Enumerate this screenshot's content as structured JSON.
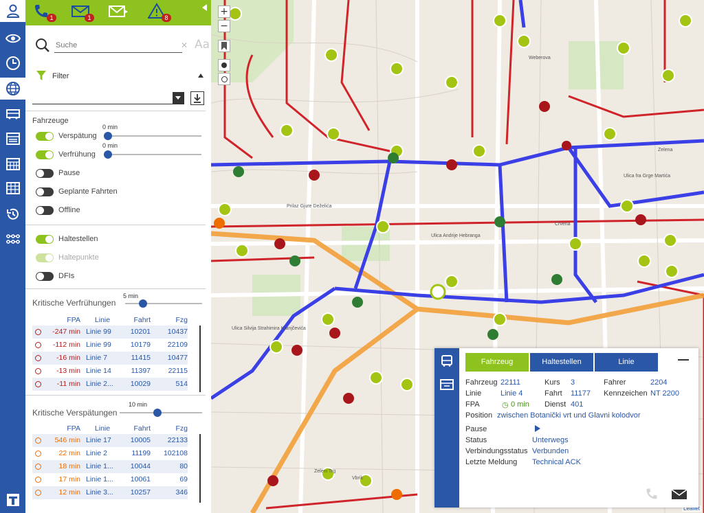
{
  "topbar": {
    "badges": {
      "phone": "1",
      "mail": "1",
      "alerts": "8"
    }
  },
  "colors": {
    "brand_blue": "#2a57a6",
    "accent_green": "#8ec31f",
    "alert_red": "#c0221c",
    "late_orange": "#ef6c00",
    "early_red": "#b71c1c"
  },
  "nav": [
    {
      "icon": "user-icon"
    },
    {
      "icon": "eye-icon"
    },
    {
      "icon": "clock-icon"
    },
    {
      "icon": "globe-icon"
    },
    {
      "icon": "bus-icon"
    },
    {
      "icon": "timetable-icon"
    },
    {
      "icon": "calendar-icon"
    },
    {
      "icon": "schedule-grid-icon"
    },
    {
      "icon": "history-icon"
    },
    {
      "icon": "route-network-icon"
    }
  ],
  "search": {
    "placeholder": "Suche",
    "font_size_label": "Aa"
  },
  "filter": {
    "label": "Filter"
  },
  "vehicles": {
    "title": "Fahrzeuge",
    "delay": {
      "label": "Verspätung",
      "on": true,
      "slider_value": "0 min",
      "slider_level": 0
    },
    "early": {
      "label": "Verfrühung",
      "on": true,
      "slider_value": "0 min",
      "slider_level": 0
    },
    "pause": {
      "label": "Pause",
      "on": false
    },
    "planned": {
      "label": "Geplante Fahrten",
      "on": false
    },
    "offline": {
      "label": "Offline",
      "on": false
    }
  },
  "stops": {
    "haltestellen": {
      "label": "Haltestellen",
      "on": true
    },
    "haltepunkte": {
      "label": "Haltepunkte",
      "on": true,
      "disabled": true
    },
    "dfis": {
      "label": "DFIs",
      "on": false
    }
  },
  "critical_early": {
    "title": "Kritische Verfrühungen",
    "slider_value": "5 min",
    "slider_level": 0.2,
    "headers": {
      "fpa": "FPA",
      "linie": "Linie",
      "fahrt": "Fahrt",
      "fzg": "Fzg"
    },
    "rows": [
      {
        "fpa": "-247 min",
        "linie": "Linie 99",
        "fahrt": "10201",
        "fzg": "10437"
      },
      {
        "fpa": "-112 min",
        "linie": "Linie 99",
        "fahrt": "10179",
        "fzg": "22109"
      },
      {
        "fpa": "-16 min",
        "linie": "Linie 7",
        "fahrt": "11415",
        "fzg": "10477"
      },
      {
        "fpa": "-13 min",
        "linie": "Linie 14",
        "fahrt": "11397",
        "fzg": "22115"
      },
      {
        "fpa": "-11 min",
        "linie": "Linie 2...",
        "fahrt": "10029",
        "fzg": "514"
      }
    ]
  },
  "critical_late": {
    "title": "Kritische Verspätungen",
    "slider_value": "10 min",
    "slider_level": 0.45,
    "headers": {
      "fpa": "FPA",
      "linie": "Linie",
      "fahrt": "Fahrt",
      "fzg": "Fzg"
    },
    "rows": [
      {
        "fpa": "546 min",
        "linie": "Linie 17",
        "fahrt": "10005",
        "fzg": "22133"
      },
      {
        "fpa": "22 min",
        "linie": "Linie 2",
        "fahrt": "11199",
        "fzg": "102108"
      },
      {
        "fpa": "18 min",
        "linie": "Linie 1...",
        "fahrt": "10044",
        "fzg": "80"
      },
      {
        "fpa": "17 min",
        "linie": "Linie 1...",
        "fahrt": "10061",
        "fzg": "69"
      },
      {
        "fpa": "12 min",
        "linie": "Linie 3...",
        "fahrt": "10257",
        "fzg": "346"
      }
    ]
  },
  "map": {
    "zoom_in": "+",
    "zoom_out": "−",
    "attribution": "Leaflet",
    "street_labels": [
      "Ulica Andrije Hebranga",
      "Ulica Silvija Strahimira Kranjčevića",
      "Ulica fra Grge Martića",
      "Prilaz Gjure Deželića",
      "Crvena",
      "Zelena",
      "Vbrik",
      "Zeleni Trg",
      "Weberova"
    ]
  },
  "popup": {
    "tabs": [
      "Fahrzeug",
      "Haltestellen",
      "Linie"
    ],
    "fahrzeug_label": "Fahrzeug",
    "fahrzeug": "22111",
    "kurs_label": "Kurs",
    "kurs": "3",
    "fahrer_label": "Fahrer",
    "fahrer": "2204",
    "linie_label": "Linie",
    "linie": "Linie 4",
    "fahrt_label": "Fahrt",
    "fahrt": "11177",
    "kennzeichen_label": "Kennzeichen",
    "kennzeichen": "NT 2200",
    "fpa_label": "FPA",
    "fpa": "0 min",
    "dienst_label": "Dienst",
    "dienst": "401",
    "position_label": "Position",
    "position": "zwischen Botanički vrt und Glavni kolodvor",
    "pause_label": "Pause",
    "status_label": "Status",
    "status": "Unterwegs",
    "verbindung_label": "Verbindungsstatus",
    "verbindung": "Verbunden",
    "meldung_label": "Letzte Meldung",
    "meldung": "Technical ACK"
  }
}
